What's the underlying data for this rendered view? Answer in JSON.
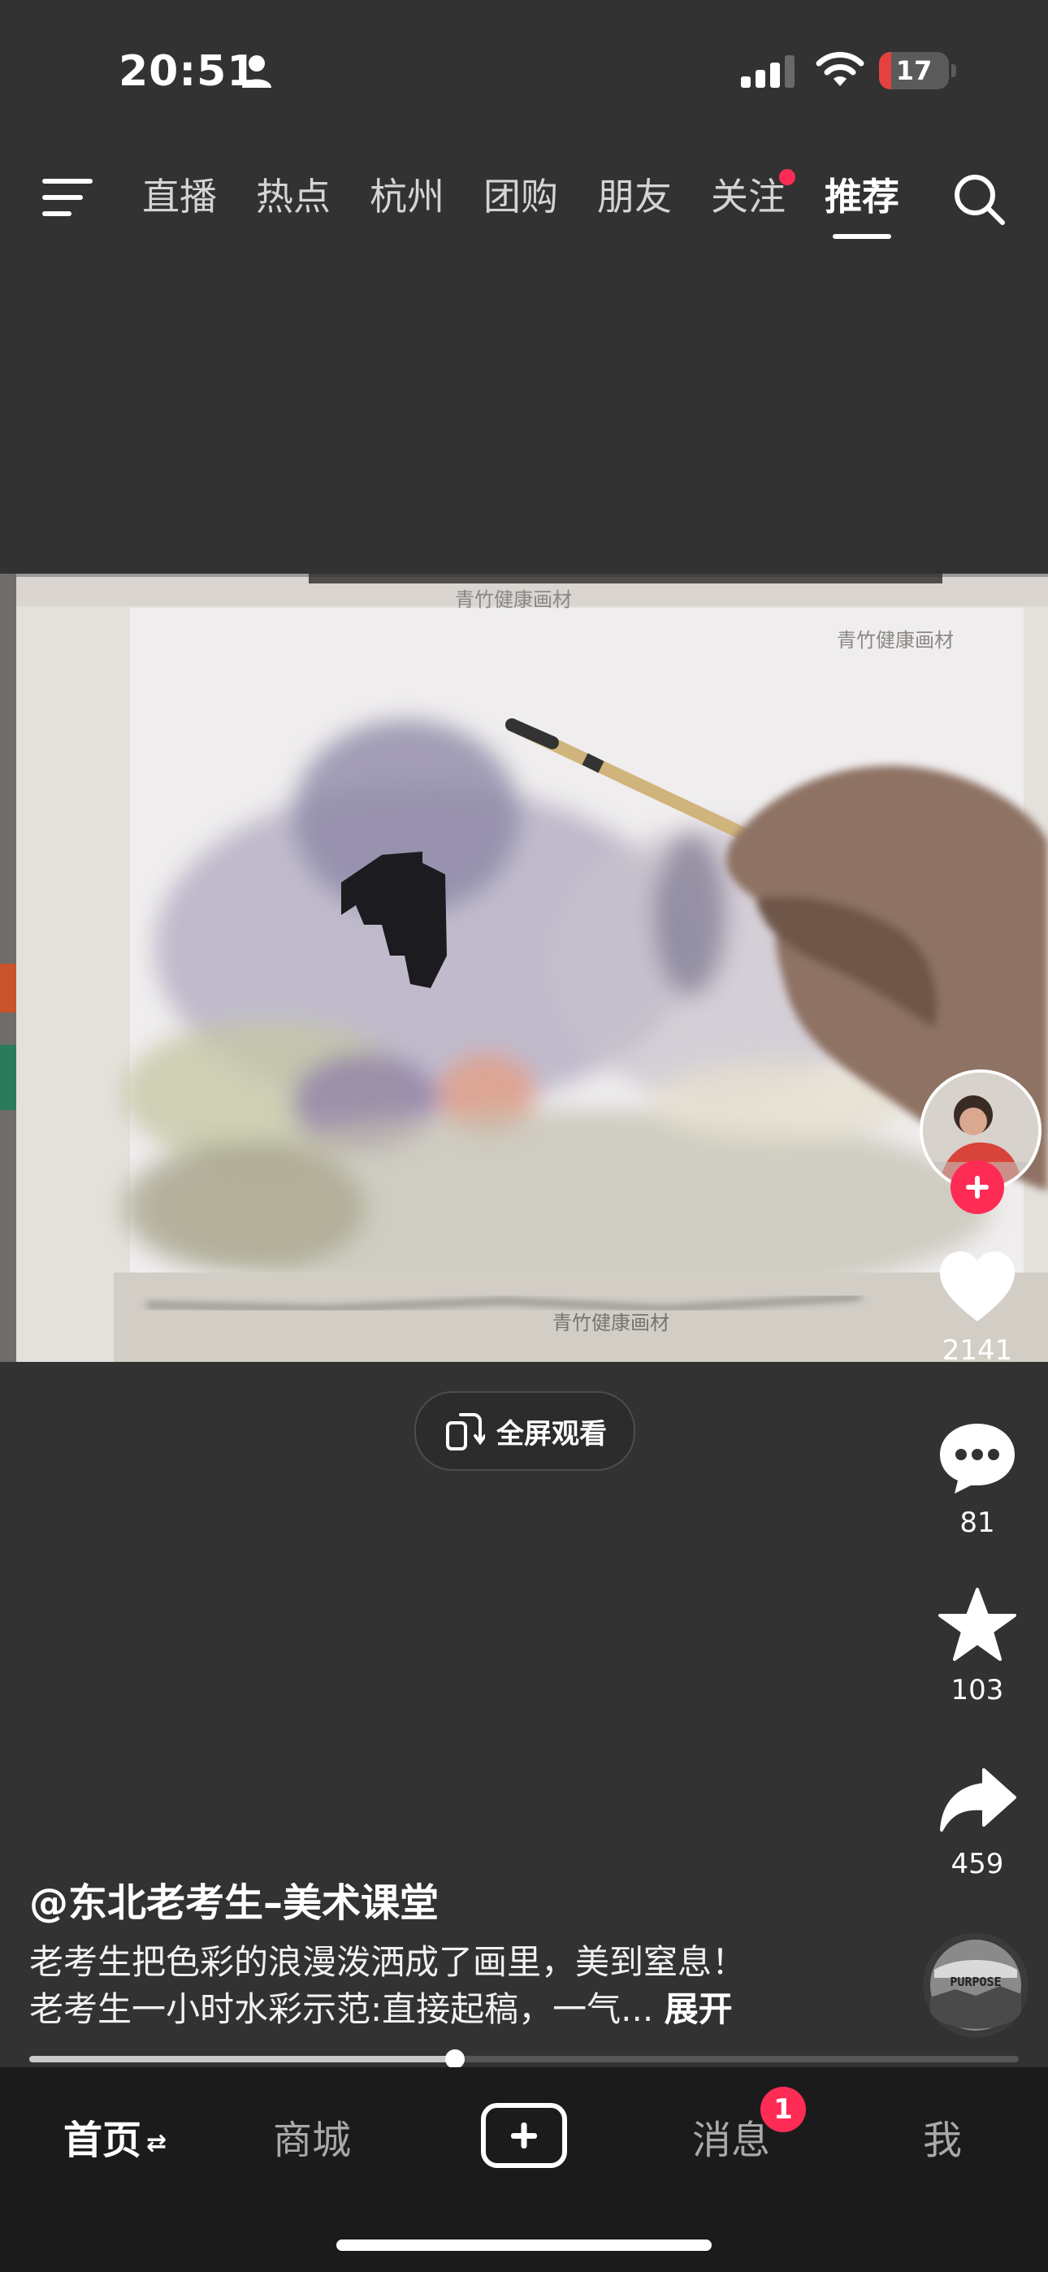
{
  "status_bar": {
    "time": "20:51",
    "battery": "17",
    "battery_level": 0.17
  },
  "top_nav": {
    "tabs": [
      {
        "label": "直播"
      },
      {
        "label": "热点"
      },
      {
        "label": "杭州"
      },
      {
        "label": "团购"
      },
      {
        "label": "朋友"
      },
      {
        "label": "关注",
        "has_dot": true
      },
      {
        "label": "推荐",
        "active": true
      }
    ]
  },
  "video": {
    "watermark": "青竹健康画材",
    "fullscreen_label": "全屏观看"
  },
  "actions": {
    "likes": "2141",
    "comments": "81",
    "favorites": "103",
    "shares": "459"
  },
  "caption": {
    "author": "@东北老考生–美术课堂",
    "line1": "老考生把色彩的浪漫泼洒成了画里，美到窒息！",
    "line2": "老考生一小时水彩示范:直接起稿，一气...",
    "expand": "展开"
  },
  "music_disc_text": "PURPOSE",
  "playback": {
    "progress": 0.43
  },
  "tab_bar": {
    "home": "首页",
    "mall": "商城",
    "messages": "消息",
    "messages_badge": "1",
    "me": "我"
  },
  "colors": {
    "accent": "#fe2c55",
    "background": "#333233",
    "tabbar": "#1c1b1c"
  }
}
